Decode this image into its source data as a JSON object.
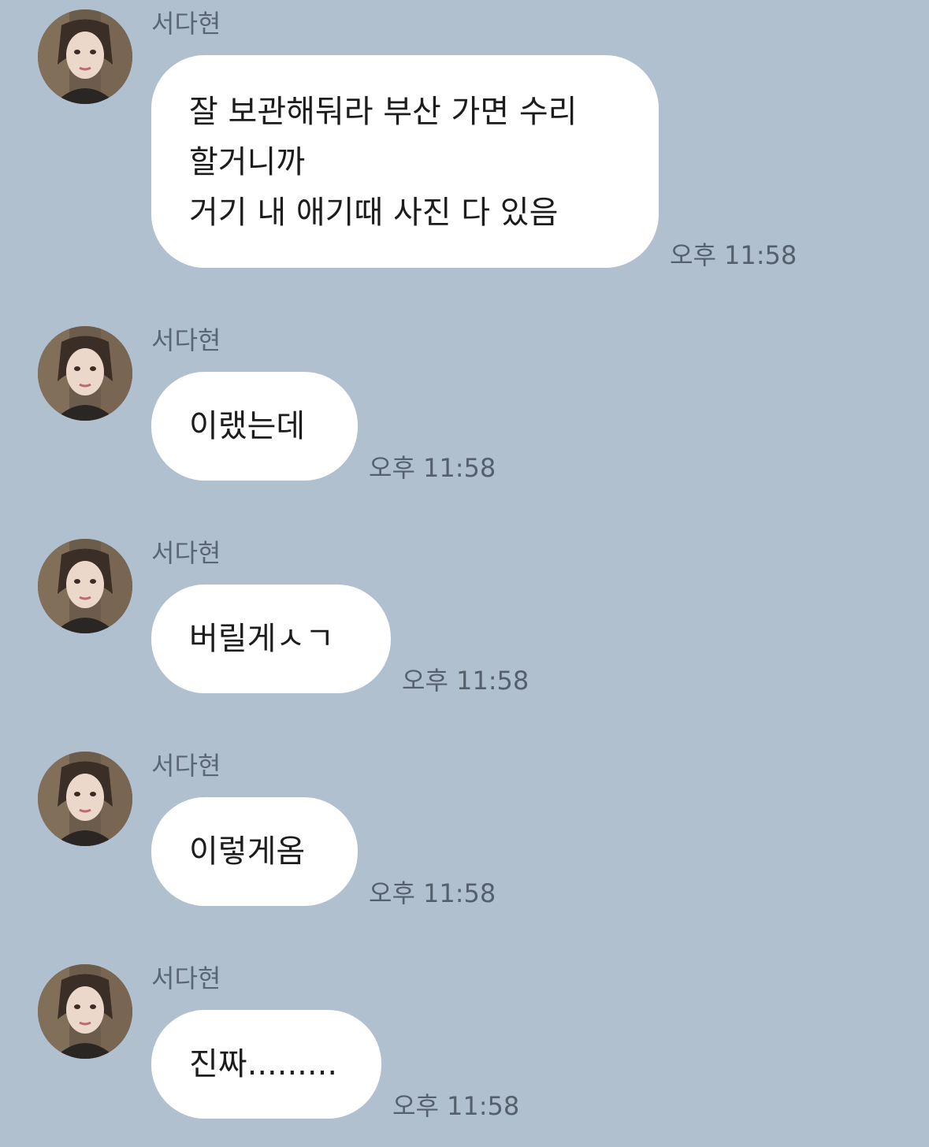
{
  "chat": {
    "messages": [
      {
        "sender": "서다현",
        "lines": [
          "잘 보관해둬라 부산 가면 수리",
          "할거니까",
          "거기 내 애기때 사진 다 있음"
        ],
        "time": "오후 11:58"
      },
      {
        "sender": "서다현",
        "lines": [
          "이랬는데"
        ],
        "time": "오후 11:58"
      },
      {
        "sender": "서다현",
        "lines": [
          "버릴게ㅅㄱ"
        ],
        "time": "오후 11:58"
      },
      {
        "sender": "서다현",
        "lines": [
          "이렇게옴"
        ],
        "time": "오후 11:58"
      },
      {
        "sender": "서다현",
        "lines": [
          "진짜........."
        ],
        "time": "오후 11:58"
      }
    ]
  },
  "colors": {
    "background": "#b1c0cf",
    "bubble": "#ffffff",
    "sender_text": "#5b6673",
    "time_text": "#55606c",
    "message_text": "#1c1c1c"
  },
  "icons": {
    "avatar": "profile-photo"
  }
}
